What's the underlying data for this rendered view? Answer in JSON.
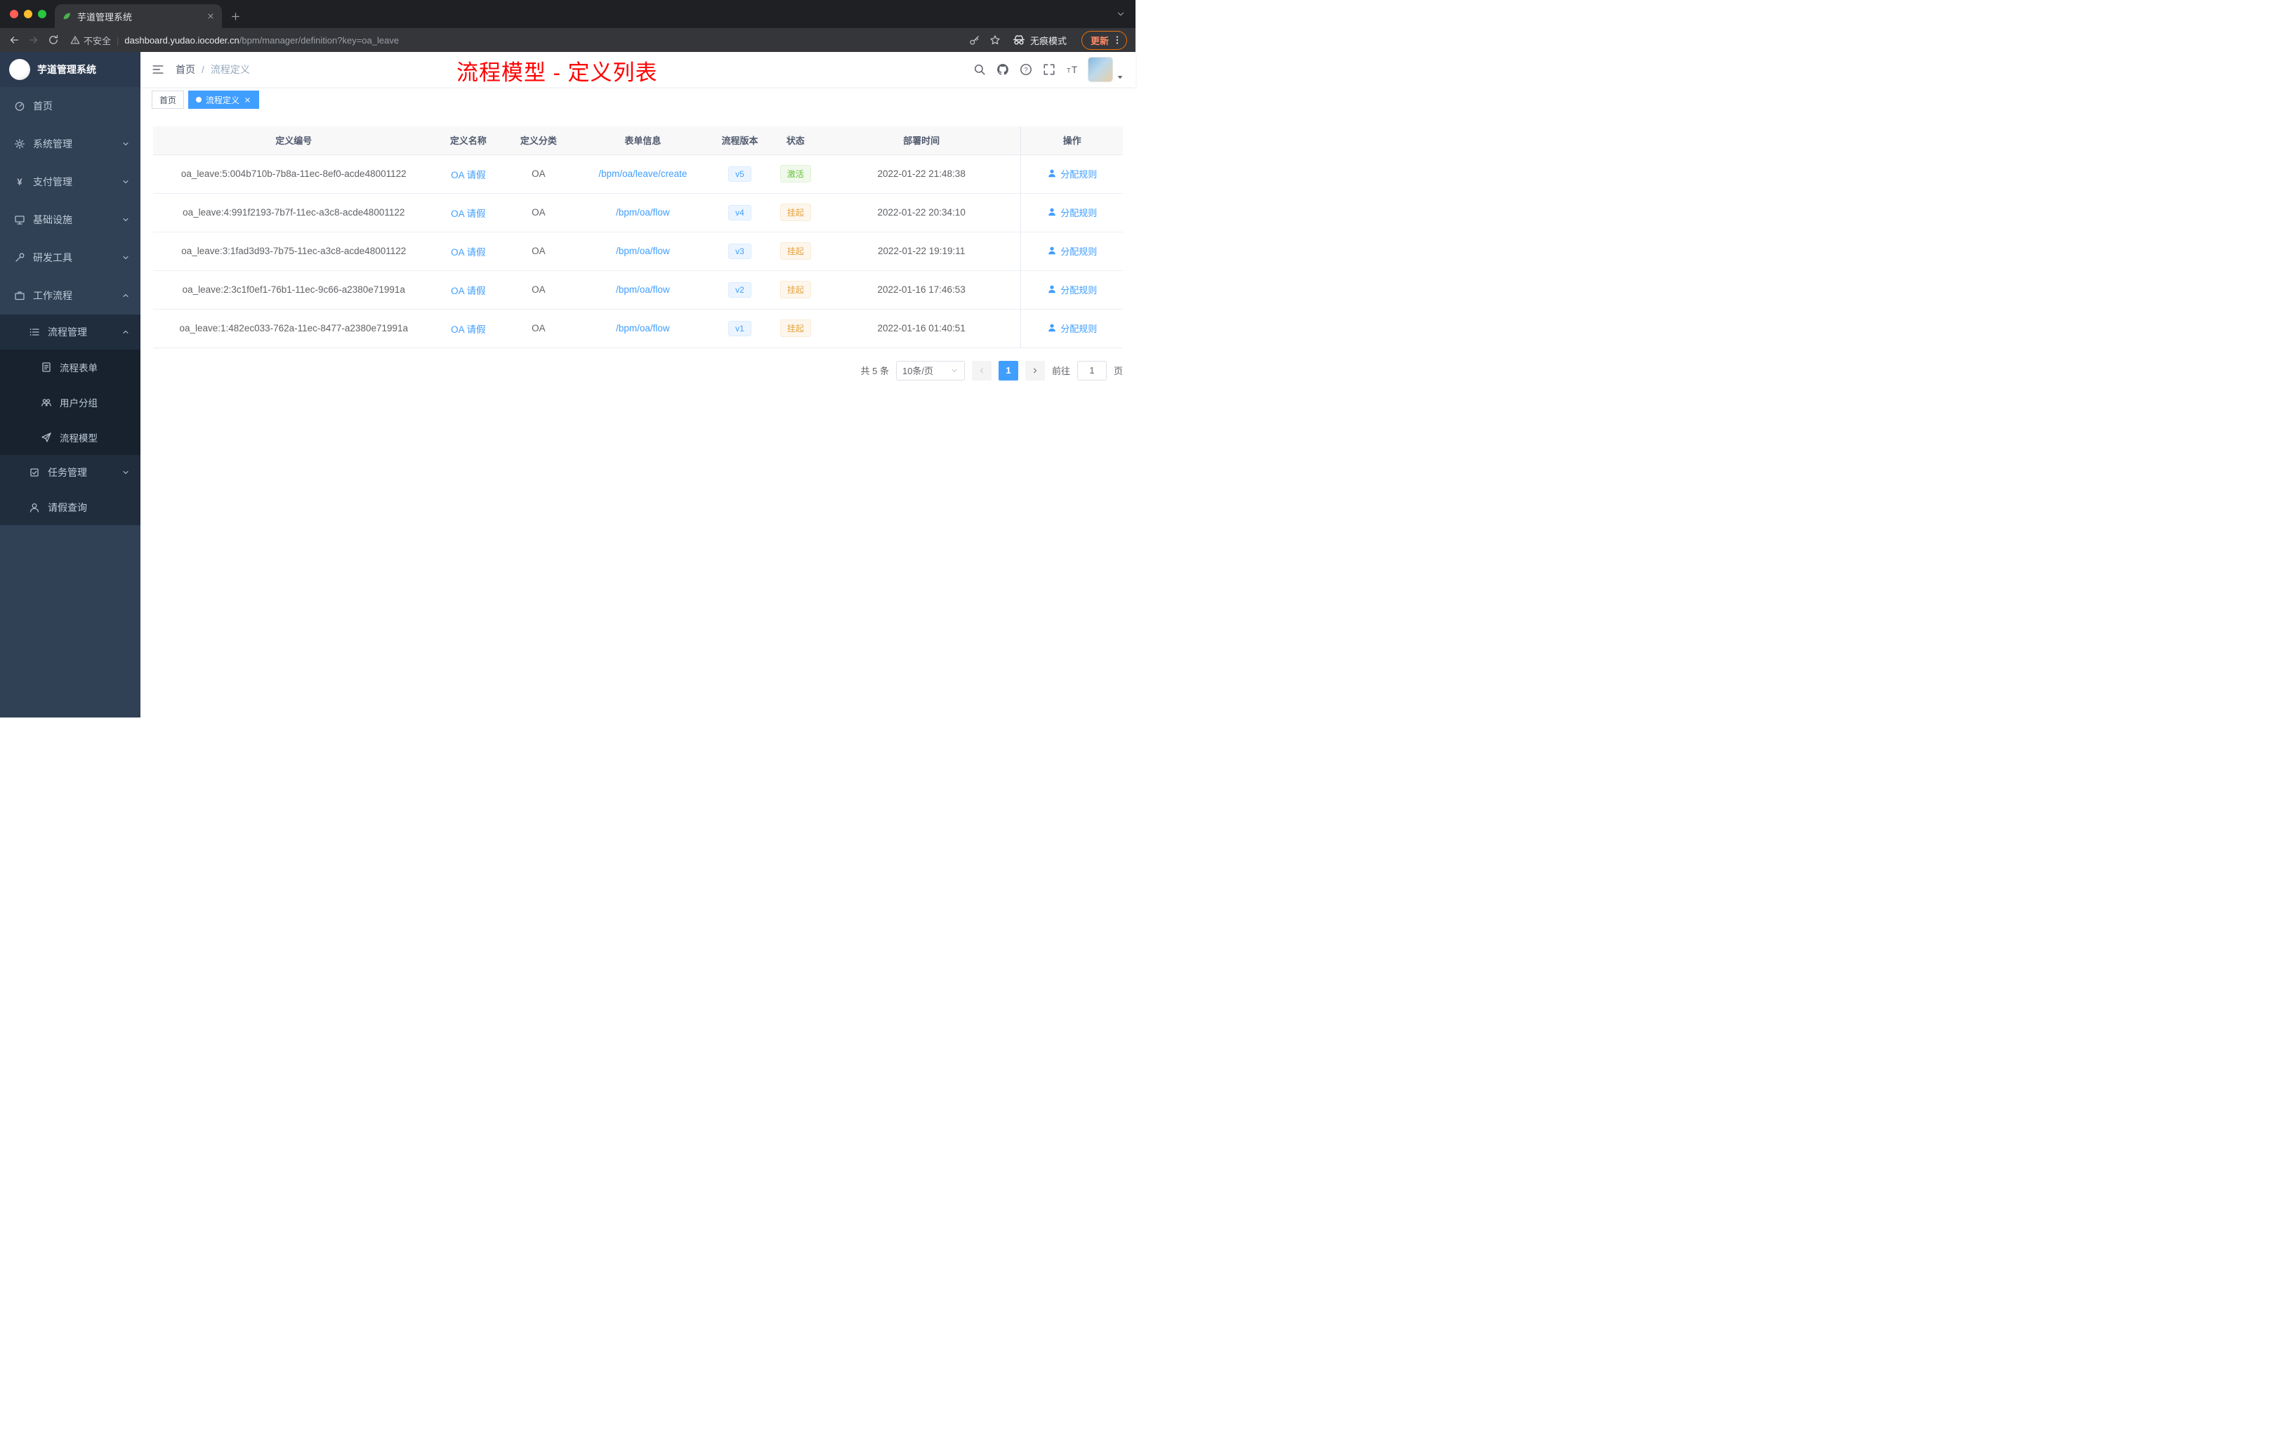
{
  "colors": {
    "accent": "#409EFF",
    "sidebar_bg": "#304156",
    "submenu_bg": "#1f2d3d",
    "annotation_red": "#ff0000",
    "success_text": "#67c23a",
    "warning_text": "#e6a23c"
  },
  "browser": {
    "tab": {
      "title": "芋道管理系统",
      "favicon": "leaf-icon"
    },
    "toolbar": {
      "security_label": "不安全",
      "url_domain": "dashboard.yudao.iocoder.cn",
      "url_path": "/bpm/manager/definition?key=oa_leave",
      "incognito_label": "无痕模式",
      "update_label": "更新"
    }
  },
  "sidebar": {
    "logo_title": "芋道管理系统",
    "items": [
      {
        "key": "home",
        "label": "首页",
        "icon": "dashboard",
        "level": 0
      },
      {
        "key": "system",
        "label": "系统管理",
        "icon": "gear",
        "level": 0,
        "chevron": "down"
      },
      {
        "key": "payment",
        "label": "支付管理",
        "icon": "yen",
        "level": 0,
        "chevron": "down"
      },
      {
        "key": "infrastructure",
        "label": "基础设施",
        "icon": "infra",
        "level": 0,
        "chevron": "down"
      },
      {
        "key": "dev-tools",
        "label": "研发工具",
        "icon": "tool",
        "level": 0,
        "chevron": "down"
      },
      {
        "key": "workflow",
        "label": "工作流程",
        "icon": "workflow",
        "level": 0,
        "chevron": "up"
      },
      {
        "key": "process-manage",
        "label": "流程管理",
        "icon": "process",
        "level": 1,
        "chevron": "up"
      },
      {
        "key": "process-form",
        "label": "流程表单",
        "icon": "form",
        "level": 2
      },
      {
        "key": "user-group",
        "label": "用户分组",
        "icon": "group",
        "level": 2
      },
      {
        "key": "process-model",
        "label": "流程模型",
        "icon": "send",
        "level": 2
      },
      {
        "key": "task-manage",
        "label": "任务管理",
        "icon": "task",
        "level": 1,
        "chevron": "down"
      },
      {
        "key": "leave-query",
        "label": "请假查询",
        "icon": "person",
        "level": 1
      }
    ]
  },
  "header": {
    "breadcrumb": [
      "首页",
      "流程定义"
    ],
    "breadcrumb_separator": "/",
    "annotation": "流程模型 - 定义列表",
    "tools": [
      "search",
      "github",
      "question",
      "fullscreen",
      "font-size"
    ]
  },
  "tags": [
    {
      "label": "首页",
      "active": false,
      "closable": false
    },
    {
      "label": "流程定义",
      "active": true,
      "closable": true
    }
  ],
  "table": {
    "columns": [
      "定义编号",
      "定义名称",
      "定义分类",
      "表单信息",
      "流程版本",
      "状态",
      "部署时间",
      "操作"
    ],
    "rows": [
      {
        "id": "oa_leave:5:004b710b-7b8a-11ec-8ef0-acde48001122",
        "name": "OA 请假",
        "category": "OA",
        "form": "/bpm/oa/leave/create",
        "version": "v5",
        "status": "激活",
        "status_type": "success",
        "deploy_time": "2022-01-22 21:48:38",
        "action": "分配规则"
      },
      {
        "id": "oa_leave:4:991f2193-7b7f-11ec-a3c8-acde48001122",
        "name": "OA 请假",
        "category": "OA",
        "form": "/bpm/oa/flow",
        "version": "v4",
        "status": "挂起",
        "status_type": "warning",
        "deploy_time": "2022-01-22 20:34:10",
        "action": "分配规则"
      },
      {
        "id": "oa_leave:3:1fad3d93-7b75-11ec-a3c8-acde48001122",
        "name": "OA 请假",
        "category": "OA",
        "form": "/bpm/oa/flow",
        "version": "v3",
        "status": "挂起",
        "status_type": "warning",
        "deploy_time": "2022-01-22 19:19:11",
        "action": "分配规则"
      },
      {
        "id": "oa_leave:2:3c1f0ef1-76b1-11ec-9c66-a2380e71991a",
        "name": "OA 请假",
        "category": "OA",
        "form": "/bpm/oa/flow",
        "version": "v2",
        "status": "挂起",
        "status_type": "warning",
        "deploy_time": "2022-01-16 17:46:53",
        "action": "分配规则"
      },
      {
        "id": "oa_leave:1:482ec033-762a-11ec-8477-a2380e71991a",
        "name": "OA 请假",
        "category": "OA",
        "form": "/bpm/oa/flow",
        "version": "v1",
        "status": "挂起",
        "status_type": "warning",
        "deploy_time": "2022-01-16 01:40:51",
        "action": "分配规则"
      }
    ]
  },
  "pagination": {
    "total": "共 5 条",
    "page_size": "10条/页",
    "current_page": "1",
    "goto_label": "前往",
    "goto_value": "1",
    "page_unit": "页"
  }
}
